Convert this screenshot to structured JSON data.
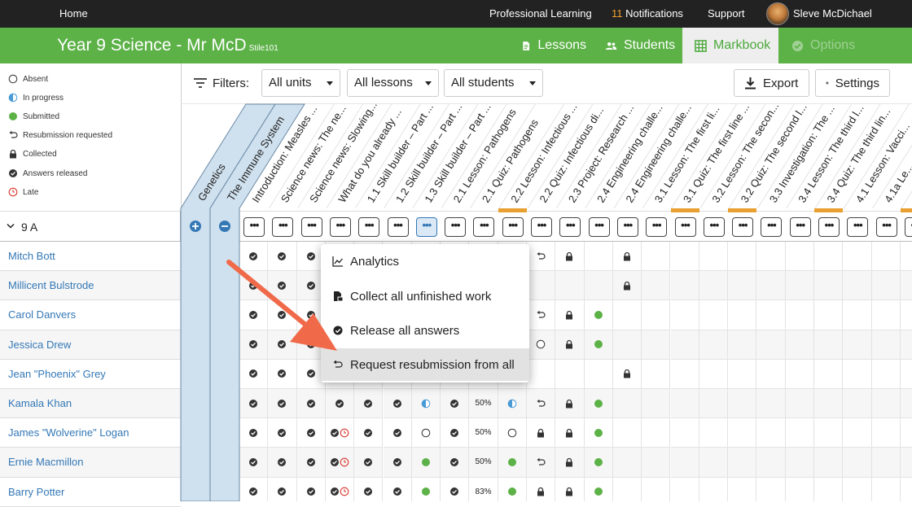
{
  "topbar": {
    "home": "Home",
    "professional_learning": "Professional Learning",
    "notifications_count": "11",
    "notifications_label": "Notifications",
    "support": "Support",
    "user_name": "Sleve McDichael"
  },
  "classbar": {
    "title": "Year 9 Science - Mr McD",
    "code": "Stile101",
    "tabs": [
      "Lessons",
      "Students",
      "Markbook",
      "Options"
    ],
    "active_tab": "Markbook"
  },
  "legend": [
    "Absent",
    "In progress",
    "Submitted",
    "Resubmission requested",
    "Collected",
    "Answers released",
    "Late"
  ],
  "filters": {
    "label": "Filters:",
    "units": "All units",
    "lessons": "All lessons",
    "students": "All students",
    "export": "Export",
    "settings": "Settings"
  },
  "units": [
    "Genetics",
    "The Immune System"
  ],
  "columns": [
    "Introduction: Measles ...",
    "Science news: The ne...",
    "Science news: Slowing...",
    "What do you already ...",
    "1.1 Skill builder – Part ...",
    "1.2 Skill builder – Part ...",
    "1.3 Skill builder – Part ...",
    "2.1 Lesson: Pathogens",
    "2.1 Quiz: Pathogens",
    "2.2 Lesson: Infectious ...",
    "2.2 Quiz: Infectious di...",
    "2.3 Project: Research ...",
    "2.4 Engineering challe...",
    "2.4 Engineering challe...",
    "3.1 Lesson: The first li...",
    "3.1 Quiz: The first line ...",
    "3.2 Lesson: The secon...",
    "3.2 Quiz: The second l...",
    "3.3 Investigation: The ...",
    "3.4 Lesson: The third l...",
    "3.4 Quiz: The third lin...",
    "4.1 Lesson: Vacci...",
    "4.1a Le..."
  ],
  "group": "9 A",
  "students": [
    "Mitch Bott",
    "Millicent Bulstrode",
    "Carol Danvers",
    "Jessica Drew",
    "Jean \"Phoenix\" Grey",
    "Kamala Khan",
    "James \"Wolverine\" Logan",
    "Ernie Macmillon",
    "Barry Potter"
  ],
  "grid": [
    [
      "r",
      "r",
      "r",
      "",
      "",
      "",
      "",
      "",
      "",
      "",
      "u",
      "c",
      "",
      "c"
    ],
    [
      "r",
      "r",
      "r",
      "",
      "",
      "",
      "",
      "",
      "",
      "",
      "",
      "",
      "",
      "c"
    ],
    [
      "r",
      "r",
      "r",
      "",
      "",
      "",
      "",
      "",
      "",
      "",
      "u",
      "c",
      "s",
      ""
    ],
    [
      "r",
      "r",
      "r",
      "",
      "",
      "",
      "",
      "",
      "",
      "",
      "a",
      "c",
      "s",
      ""
    ],
    [
      "r",
      "r",
      "r",
      "",
      "",
      "",
      "",
      "",
      "",
      "",
      "",
      "",
      "",
      "c"
    ],
    [
      "r",
      "r",
      "r",
      "r",
      "r",
      "r",
      "p",
      "r",
      "50%",
      "p",
      "u",
      "c",
      "s",
      ""
    ],
    [
      "r",
      "r",
      "r",
      "rl",
      "r",
      "r",
      "a",
      "r",
      "50%",
      "a",
      "c",
      "c",
      "s",
      ""
    ],
    [
      "r",
      "r",
      "r",
      "rl",
      "r",
      "r",
      "s",
      "r",
      "50%",
      "s",
      "u",
      "c",
      "s",
      ""
    ],
    [
      "r",
      "r",
      "r",
      "rl",
      "r",
      "r",
      "s",
      "r",
      "83%",
      "s",
      "c",
      "c",
      "s",
      ""
    ]
  ],
  "menu": {
    "items": [
      "Analytics",
      "Collect all unfinished work",
      "Release all answers",
      "Request resubmission from all"
    ],
    "highlighted": "Request resubmission from all"
  },
  "colors": {
    "brand": "#5cb147",
    "topbar": "#222222",
    "link": "#3478b6",
    "accent": "#e8a030",
    "annotation_arrow": "#f06a4a"
  }
}
